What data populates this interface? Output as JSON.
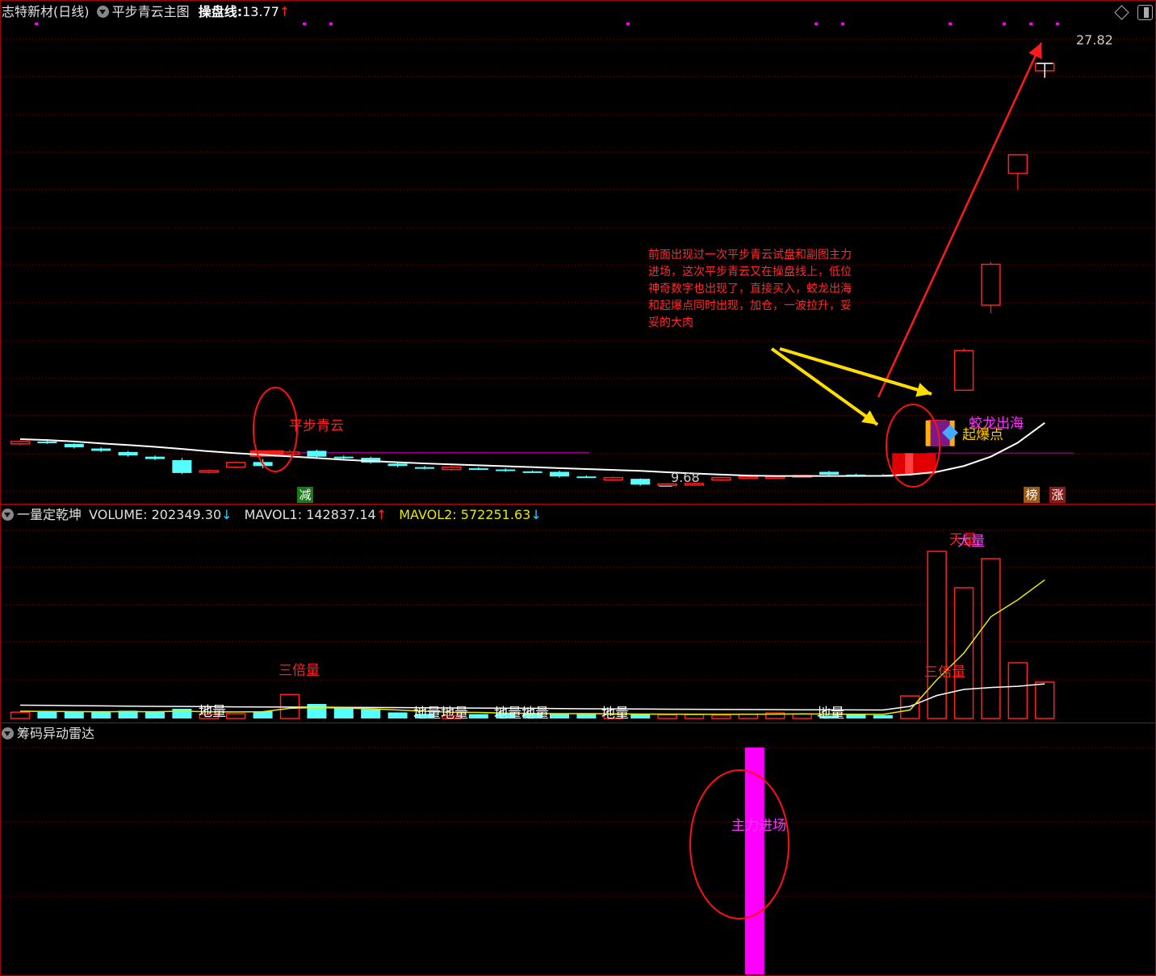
{
  "header": {
    "stock_title": "志特新材(日线)",
    "indicator_name": "平步青云主图",
    "line_label": "操盘线:",
    "line_value": "13.77",
    "line_dir": "↑"
  },
  "volume_panel": {
    "name": "一量定乾坤",
    "volume_label": "VOLUME:",
    "volume_value": "202349.30",
    "volume_dir": "↓",
    "mavol1_label": "MAVOL1:",
    "mavol1_value": "142837.14",
    "mavol1_dir": "↑",
    "mavol2_label": "MAVOL2:",
    "mavol2_value": "572251.63",
    "mavol2_dir": "↓"
  },
  "radar_panel": {
    "name": "筹码异动雷达",
    "signal_label": "主力进场"
  },
  "annotation": "前面出现过一次平步青云试盘和副图主力进场，这次平步青云又在操盘线上，低位神奇数字也出现了，直接买入，蛟龙出海和起爆点同时出现，加仓，一波拉升，妥妥的大肉",
  "signals": {
    "pingbu_qingyun": "平步青云",
    "jiaolong_chuhai": "蛟龙出海",
    "qibao_dian": "起爆点",
    "jian_badge": "减",
    "bang_badge": "榜",
    "zhang_badge": "涨",
    "high_label": "27.82",
    "low_label": "9.68",
    "sanbeiliang": "三倍量",
    "tianliang": "天量",
    "daliang": "大量",
    "diliang": "地量"
  },
  "colors": {
    "up": "#ff2020",
    "down": "#55ffff",
    "ma": "#ffffff",
    "mavol2": "#e8e800",
    "grid": "#8b0000",
    "magenta": "#ff00ff",
    "purple": "#8a008a",
    "annotation_arrow": "#ffdd00"
  },
  "chart_data": [
    {
      "type": "candlestick",
      "title": "志特新材(日线)",
      "series": [
        {
          "name": "K",
          "candles": [
            {
              "o": 11.6,
              "c": 11.5,
              "h": 11.65,
              "l": 11.45,
              "dir": "up"
            },
            {
              "o": 11.6,
              "c": 11.58,
              "h": 11.7,
              "l": 11.5,
              "dir": "down"
            },
            {
              "o": 11.5,
              "c": 11.35,
              "h": 11.52,
              "l": 11.3,
              "dir": "down"
            },
            {
              "o": 11.3,
              "c": 11.2,
              "h": 11.35,
              "l": 11.15,
              "dir": "down"
            },
            {
              "o": 11.15,
              "c": 11.0,
              "h": 11.2,
              "l": 10.95,
              "dir": "down"
            },
            {
              "o": 10.95,
              "c": 10.85,
              "h": 11.0,
              "l": 10.8,
              "dir": "down"
            },
            {
              "o": 10.8,
              "c": 10.25,
              "h": 10.9,
              "l": 10.2,
              "dir": "down"
            },
            {
              "o": 10.28,
              "c": 10.35,
              "h": 10.4,
              "l": 10.22,
              "dir": "up"
            },
            {
              "o": 10.5,
              "c": 10.7,
              "h": 10.75,
              "l": 10.45,
              "dir": "up"
            },
            {
              "o": 10.72,
              "c": 10.55,
              "h": 10.85,
              "l": 10.45,
              "dir": "down"
            },
            {
              "o": 11.05,
              "c": 11.15,
              "h": 11.25,
              "l": 10.95,
              "dir": "up"
            },
            {
              "o": 11.2,
              "c": 10.95,
              "h": 11.25,
              "l": 10.9,
              "dir": "down"
            },
            {
              "o": 10.95,
              "c": 10.9,
              "h": 11.0,
              "l": 10.85,
              "dir": "down"
            },
            {
              "o": 10.9,
              "c": 10.7,
              "h": 10.95,
              "l": 10.65,
              "dir": "down"
            },
            {
              "o": 10.65,
              "c": 10.55,
              "h": 10.7,
              "l": 10.5,
              "dir": "down"
            },
            {
              "o": 10.5,
              "c": 10.44,
              "h": 10.55,
              "l": 10.4,
              "dir": "down"
            },
            {
              "o": 10.4,
              "c": 10.5,
              "h": 10.55,
              "l": 10.35,
              "dir": "up"
            },
            {
              "o": 10.45,
              "c": 10.42,
              "h": 10.5,
              "l": 10.38,
              "dir": "down"
            },
            {
              "o": 10.4,
              "c": 10.34,
              "h": 10.45,
              "l": 10.3,
              "dir": "down"
            },
            {
              "o": 10.32,
              "c": 10.3,
              "h": 10.36,
              "l": 10.28,
              "dir": "down"
            },
            {
              "o": 10.3,
              "c": 10.1,
              "h": 10.35,
              "l": 10.05,
              "dir": "down"
            },
            {
              "o": 10.1,
              "c": 10.08,
              "h": 10.15,
              "l": 10.05,
              "dir": "down"
            },
            {
              "o": 9.95,
              "c": 10.05,
              "h": 10.1,
              "l": 9.9,
              "dir": "up"
            },
            {
              "o": 10.0,
              "c": 9.75,
              "h": 10.02,
              "l": 9.7,
              "dir": "down"
            },
            {
              "o": 9.73,
              "c": 9.78,
              "h": 9.82,
              "l": 9.68,
              "dir": "up"
            },
            {
              "o": 9.75,
              "c": 9.8,
              "h": 9.85,
              "l": 9.7,
              "dir": "up"
            },
            {
              "o": 9.95,
              "c": 10.05,
              "h": 10.1,
              "l": 9.9,
              "dir": "up"
            },
            {
              "o": 10.05,
              "c": 10.1,
              "h": 10.15,
              "l": 10.0,
              "dir": "up"
            },
            {
              "o": 10.1,
              "c": 10.1,
              "h": 10.15,
              "l": 10.05,
              "dir": "up"
            },
            {
              "o": 10.1,
              "c": 10.14,
              "h": 10.18,
              "l": 10.06,
              "dir": "up"
            },
            {
              "o": 10.3,
              "c": 10.18,
              "h": 10.34,
              "l": 10.15,
              "dir": "down"
            },
            {
              "o": 10.18,
              "c": 10.16,
              "h": 10.22,
              "l": 10.12,
              "dir": "down"
            },
            {
              "o": 10.16,
              "c": 10.14,
              "h": 10.2,
              "l": 10.1,
              "dir": "down"
            },
            {
              "o": 10.2,
              "c": 10.95,
              "h": 11.05,
              "l": 10.15,
              "dir": "up"
            },
            {
              "o": 11.7,
              "c": 12.5,
              "h": 12.55,
              "l": 11.4,
              "dir": "up"
            },
            {
              "o": 13.8,
              "c": 15.5,
              "h": 15.6,
              "l": 13.8,
              "dir": "up"
            },
            {
              "o": 17.45,
              "c": 19.2,
              "h": 19.3,
              "l": 17.1,
              "dir": "up"
            },
            {
              "o": 23.1,
              "c": 23.9,
              "h": 23.9,
              "l": 22.4,
              "dir": "up"
            },
            {
              "o": 27.5,
              "c": 27.82,
              "h": 27.82,
              "l": 27.5,
              "dir": "up"
            }
          ]
        },
        {
          "name": "操盘线",
          "values": [
            11.7,
            11.66,
            11.6,
            11.52,
            11.45,
            11.37,
            11.28,
            11.18,
            11.1,
            11.03,
            10.96,
            10.89,
            10.82,
            10.76,
            10.71,
            10.66,
            10.62,
            10.58,
            10.54,
            10.5,
            10.46,
            10.42,
            10.38,
            10.34,
            10.28,
            10.23,
            10.18,
            10.14,
            10.12,
            10.12,
            10.12,
            10.12,
            10.13,
            10.18,
            10.3,
            10.55,
            10.95,
            11.55,
            12.4
          ]
        }
      ],
      "ylim": [
        9.0,
        29.5
      ],
      "annotations": [
        "平步青云",
        "蛟龙出海",
        "起爆点",
        "27.82",
        "9.68"
      ]
    },
    {
      "type": "bar",
      "title": "一量定乾坤",
      "series": [
        {
          "name": "VOLUME",
          "values": [
            26000,
            29000,
            30000,
            27000,
            32000,
            28000,
            40000,
            16000,
            20000,
            30000,
            99000,
            60000,
            45000,
            38000,
            25000,
            19000,
            11000,
            18000,
            20000,
            22000,
            19000,
            22000,
            16000,
            17000,
            15000,
            16000,
            14000,
            18000,
            23000,
            18000,
            12000,
            17000,
            14000,
            93000,
            690000,
            540000,
            660000,
            230000,
            150000
          ]
        },
        {
          "name": "MAVOL1",
          "values": [
            55000,
            54000,
            53000,
            52000,
            51000,
            50000,
            49500,
            49000,
            48000,
            47500,
            47000,
            46500,
            46000,
            45500,
            45000,
            44000,
            43500,
            43000,
            42500,
            42000,
            41000,
            40000,
            39500,
            39000,
            38500,
            38000,
            37500,
            37000,
            36500,
            36000,
            36000,
            35500,
            35000,
            50000,
            95000,
            120000,
            128000,
            133000,
            142837
          ]
        },
        {
          "name": "MAVOL2",
          "values": [
            30000,
            29000,
            28500,
            28000,
            28500,
            28000,
            30000,
            27500,
            27000,
            28000,
            42000,
            45000,
            43000,
            40000,
            35000,
            30000,
            26000,
            25000,
            22000,
            21000,
            20000,
            20000,
            19000,
            18500,
            18000,
            17500,
            17000,
            17500,
            18000,
            19000,
            18000,
            17500,
            17000,
            35000,
            160000,
            270000,
            420000,
            490000,
            572251
          ]
        }
      ],
      "ylim": [
        0,
        800000
      ],
      "annotations": [
        "三倍量",
        "天量",
        "大量",
        "地量"
      ]
    },
    {
      "type": "bar",
      "title": "筹码异动雷达",
      "series": [
        {
          "name": "主力进场",
          "values": [
            0,
            0,
            0,
            0,
            0,
            0,
            0,
            0,
            0,
            0,
            0,
            0,
            0,
            0,
            0,
            0,
            0,
            0,
            0,
            0,
            0,
            0,
            0,
            0,
            0,
            0,
            0,
            1,
            0,
            0,
            0,
            0,
            0,
            0,
            0,
            0,
            0,
            0,
            0
          ]
        }
      ],
      "ylim": [
        0,
        1
      ]
    }
  ]
}
